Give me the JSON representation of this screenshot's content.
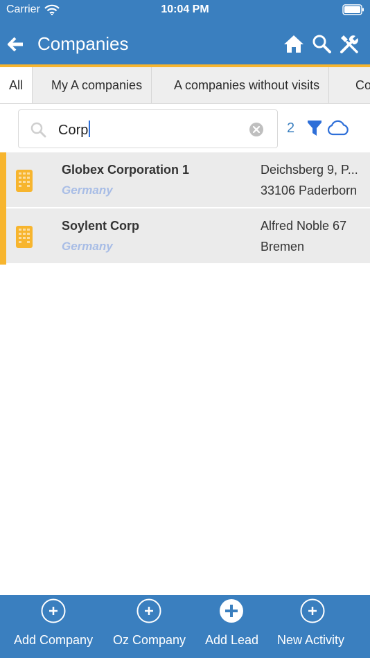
{
  "status_bar": {
    "carrier": "Carrier",
    "time": "10:04 PM"
  },
  "header": {
    "title": "Companies",
    "icons": [
      "back-arrow-icon",
      "home-icon",
      "search-icon",
      "tools-icon"
    ]
  },
  "tabs": [
    {
      "label": "All",
      "active": true
    },
    {
      "label": "My A companies",
      "active": false
    },
    {
      "label": "A companies without visits",
      "active": false
    },
    {
      "label": "Co",
      "active": false
    }
  ],
  "search": {
    "value": "Corp",
    "result_count": "2"
  },
  "companies": [
    {
      "name": "Globex Corporation 1",
      "country": "Germany",
      "address_line1": "Deichsberg 9, P...",
      "address_line2": "33106 Paderborn"
    },
    {
      "name": "Soylent Corp",
      "country": "Germany",
      "address_line1": "Alfred Noble 67",
      "address_line2": "Bremen"
    }
  ],
  "bottom_actions": [
    {
      "label": "Add Company",
      "icon": "plus-circle-outline-icon"
    },
    {
      "label": "Oz Company",
      "icon": "plus-circle-outline-icon"
    },
    {
      "label": "Add Lead",
      "icon": "plus-circle-filled-icon"
    },
    {
      "label": "New Activity",
      "icon": "plus-circle-outline-icon"
    }
  ],
  "colors": {
    "primary": "#3a7fbf",
    "accent": "#f7b52e",
    "country_text": "#a8bde6",
    "row_background": "#ebebeb"
  }
}
